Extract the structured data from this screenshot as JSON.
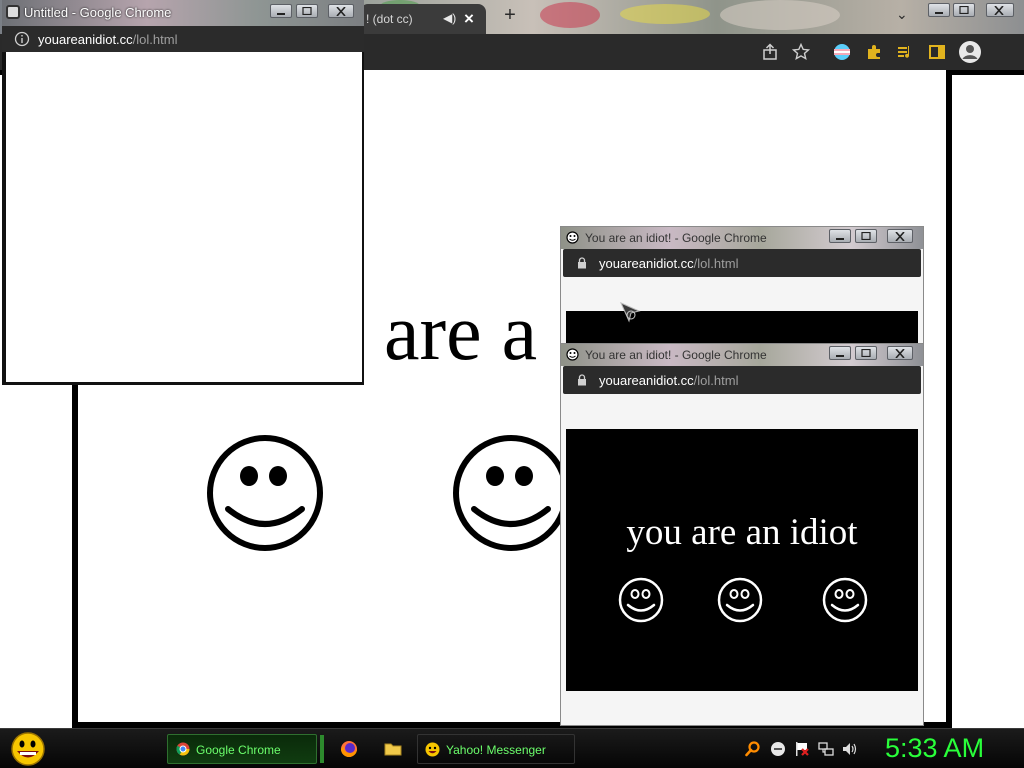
{
  "main_window": {
    "tab": {
      "label": "! (dot cc)",
      "audio_icon": "speaker-icon",
      "close_icon": "close-icon"
    },
    "new_tab_label": "+",
    "tab_list_label": "⌄",
    "toolbar_icons": [
      "share-icon",
      "bookmark-star-icon",
      "profile-flag-icon",
      "extensions-puzzle-icon",
      "media-queue-icon",
      "side-panel-icon",
      "account-icon"
    ],
    "page": {
      "big_text": "are a"
    }
  },
  "popup_untitled": {
    "title": "Untitled - Google Chrome",
    "url_host": "youareanidiot.cc",
    "url_path": "/lol.html",
    "info_icon": "info-icon"
  },
  "idiot_popup_top": {
    "title": "You are an idiot! - Google Chrome",
    "url_host": "youareanidiot.cc",
    "url_path": "/lol.html"
  },
  "idiot_popup_bottom": {
    "title": "You are an idiot! - Google Chrome",
    "url_host": "youareanidiot.cc",
    "url_path": "/lol.html",
    "content_text": "you are an idiot"
  },
  "taskbar": {
    "start_icon": "yahoo-smiley-icon",
    "items": [
      {
        "label": "Google Chrome",
        "icon": "chrome-icon"
      },
      {
        "label": "Yahoo! Messenger",
        "icon": "yahoo-messenger-icon"
      }
    ],
    "quick_launch": [
      "firefox-icon",
      "folder-icon"
    ],
    "tray_icons": [
      "search-icon",
      "messenger-status-icon",
      "security-flag-icon",
      "network-icon",
      "volume-icon"
    ],
    "clock": "5:33 AM"
  },
  "colors": {
    "taskbar_text": "#6cff6c",
    "clock": "#29ff3a",
    "url_path": "#9e9e9e"
  }
}
